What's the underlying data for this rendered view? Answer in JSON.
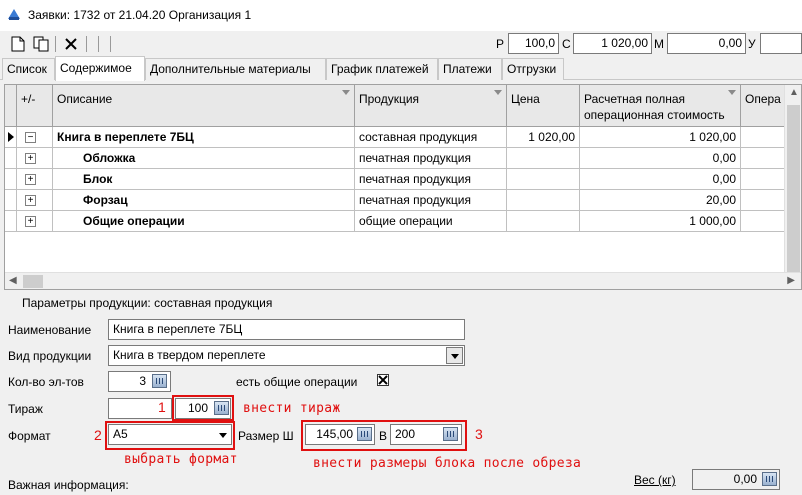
{
  "window": {
    "title": "Заявки: 1732 от 21.04.20  Организация 1"
  },
  "toolbar": {
    "fields": [
      {
        "label": "Р",
        "value": "100,0"
      },
      {
        "label": "С",
        "value": "1 020,00"
      },
      {
        "label": "М",
        "value": "0,00"
      },
      {
        "label": "У",
        "value": ""
      }
    ]
  },
  "tabs": [
    "Список",
    "Содержимое",
    "Дополнительные материалы",
    "График платежей",
    "Платежи",
    "Отгрузки"
  ],
  "grid": {
    "columns": [
      "+/-",
      "Описание",
      "Продукция",
      "Цена",
      "Расчетная полная операционная стоимость",
      "Опера"
    ],
    "rows": [
      {
        "expander": "−",
        "description": "Книга в переплете 7БЦ",
        "product": "составная продукция",
        "price": "1 020,00",
        "cost": "1 020,00"
      },
      {
        "expander": "+",
        "description": "Обложка",
        "product": "печатная продукция",
        "price": "",
        "cost": "0,00"
      },
      {
        "expander": "+",
        "description": "Блок",
        "product": "печатная продукция",
        "price": "",
        "cost": "0,00"
      },
      {
        "expander": "+",
        "description": "Форзац",
        "product": "печатная продукция",
        "price": "",
        "cost": "20,00"
      },
      {
        "expander": "+",
        "description": "Общие операции",
        "product": "общие операции",
        "price": "",
        "cost": "1 000,00"
      }
    ]
  },
  "params": {
    "title": "Параметры продукции: составная продукция",
    "name_label": "Наименование",
    "name_value": "Книга в переплете 7БЦ",
    "type_label": "Вид продукции",
    "type_value": "Книга в твердом переплете",
    "count_label": "Кол-во эл-тов",
    "count_value": "3",
    "common_ops_label": "есть общие операции",
    "common_ops_checked": true,
    "circulation_label": "Тираж",
    "circulation_value": "100",
    "format_label": "Формат",
    "format_value": "А5",
    "size_label": "Размер Ш",
    "width_value": "145,00",
    "height_label": "В",
    "height_value": "200",
    "important_label": "Важная информация:",
    "weight_label": "Вес (кг)",
    "weight_value": "0,00"
  },
  "annotations": {
    "n1": "1",
    "n2": "2",
    "n3": "3",
    "circulation_hint": "внести тираж",
    "format_hint": "выбрать формат",
    "size_hint": "внести размеры блока после обреза",
    "color": "#e01010"
  }
}
